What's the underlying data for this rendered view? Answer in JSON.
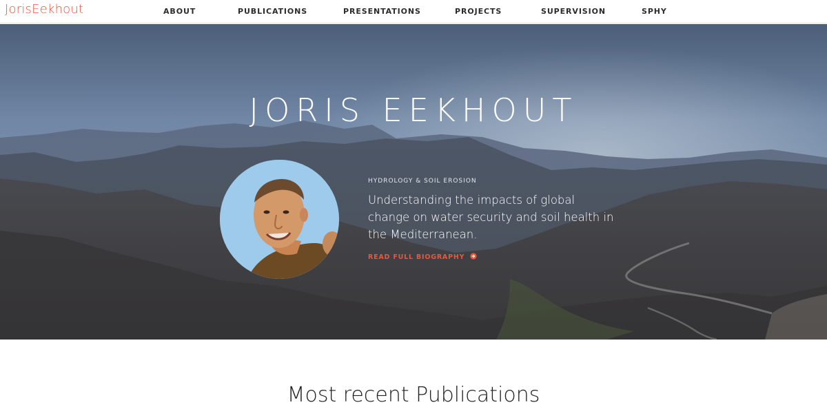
{
  "brand": {
    "name": "JorisEekhout"
  },
  "nav": {
    "items": [
      {
        "label": "ABOUT"
      },
      {
        "label": "PUBLICATIONS"
      },
      {
        "label": "PRESENTATIONS"
      },
      {
        "label": "PROJECTS"
      },
      {
        "label": "SUPERVISION"
      },
      {
        "label": "SPHY"
      }
    ]
  },
  "hero": {
    "title": "JORIS EEKHOUT",
    "subtitle": "HYDROLOGY & SOIL EROSION",
    "tagline": "Understanding the impacts of global change on water security and soil health in the Mediterranean.",
    "bio_link_label": "READ FULL BIOGRAPHY"
  },
  "sections": {
    "next_heading": "Most recent Publications"
  },
  "colors": {
    "accent": "#e8563b",
    "nav_text": "#2b2b2b",
    "hero_text": "#ffffff"
  },
  "icons": {
    "bio_link": "arrow-circle-right-icon"
  }
}
